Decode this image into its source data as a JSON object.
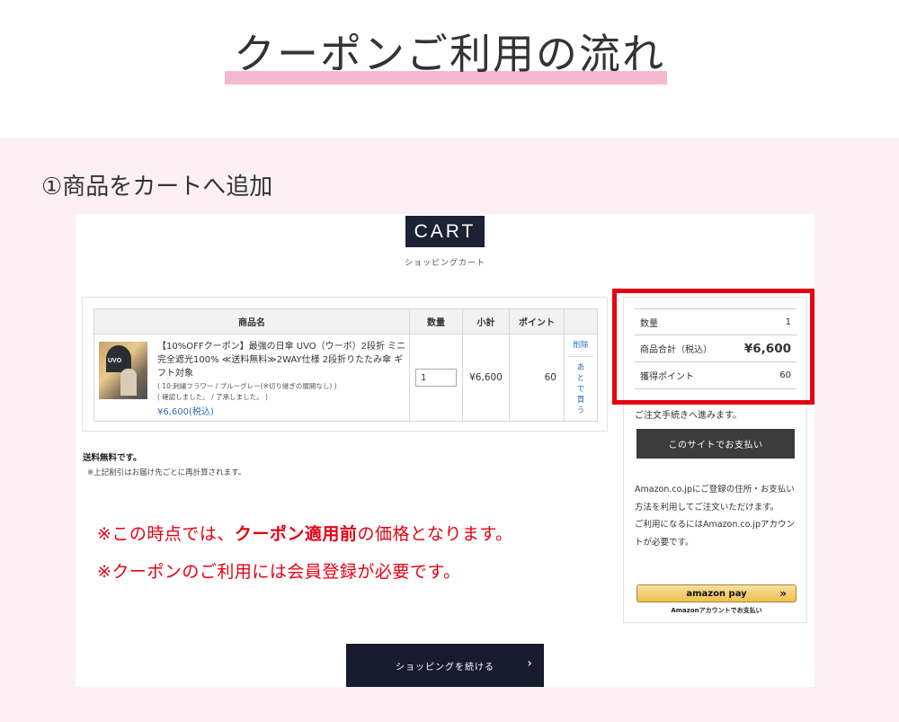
{
  "page": {
    "title": "クーポンご利用の流れ",
    "step_heading": "①商品をカートへ追加"
  },
  "cart": {
    "logo": "CART",
    "subtitle": "ショッピングカート",
    "headers": {
      "name": "商品名",
      "qty": "数量",
      "subtotal": "小計",
      "points": "ポイント"
    },
    "item": {
      "thumb_text": "UVO",
      "name": "【10%OFFクーポン】最強の日傘 UVO（ウーボ）2段折 ミニ 完全遮光100% ≪送料無料≫2WAY仕様 2段折りたたみ傘 ギフト対象",
      "options": "( 10:刺繍フラワー / ブルーグレー(※切り継ぎの展開なし) )",
      "options2": "( 確認しました。 / 了承しました。 )",
      "price": "¥6,600(税込)",
      "qty": "1",
      "subtotal": "¥6,600",
      "points": "60",
      "delete_label": "削除",
      "later_label": "あとで買う"
    },
    "shipping_free": "送料無料です。",
    "shipping_note": "※上記割引はお届け先ごとに再計算されます。",
    "continue_label": "ショッピングを続ける",
    "continue_chev": "›"
  },
  "notes": {
    "line1_pre": "※この時点では、",
    "line1_bold": "クーポン適用前",
    "line1_post": "の価格となります。",
    "line2": "※クーポンのご利用には会員登録が必要です。"
  },
  "summary": {
    "qty_label": "数量",
    "qty_value": "1",
    "total_label": "商品合計（税込）",
    "total_value": "¥6,600",
    "points_label": "獲得ポイント",
    "points_value": "60",
    "proceed_text": "ご注文手続きへ進みます。",
    "site_pay_label": "このサイトでお支払い",
    "amazon_text1": "Amazon.co.jpにご登録の住所・お支払い方法を利用してご注文いただけます。",
    "amazon_text2": "ご利用になるにはAmazon.co.jpアカウントが必要です。",
    "amazon_pay_label": "amazon pay",
    "amazon_pay_chev": "»",
    "amazon_caption": "Amazonアカウントでお支払い"
  },
  "colors": {
    "accent_red": "#e60012",
    "navy": "#1c2233",
    "pink_bg": "#fdf0f4",
    "pink_underline": "#f4b8cf",
    "link_blue": "#2c6fb3"
  }
}
